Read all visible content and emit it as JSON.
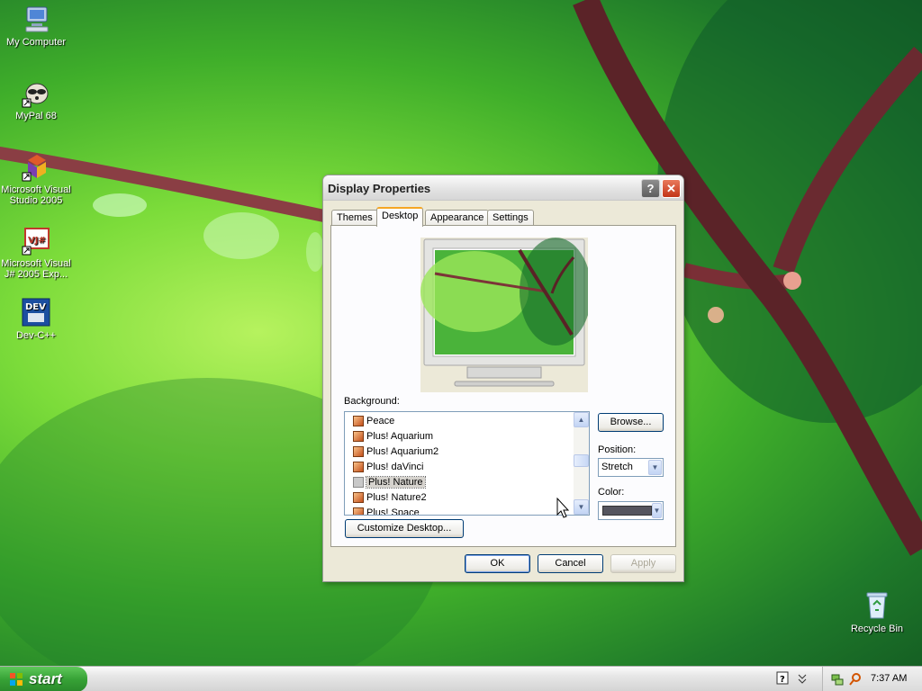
{
  "desktop": {
    "icons": [
      {
        "label": "My Computer"
      },
      {
        "label": "MyPal 68"
      },
      {
        "label": "Microsoft Visual Studio 2005"
      },
      {
        "label": "Microsoft Visual J# 2005 Exp..."
      },
      {
        "label": "Dev-C++"
      },
      {
        "label": "Recycle Bin"
      }
    ]
  },
  "dialog": {
    "title": "Display Properties",
    "help_glyph": "?",
    "close_glyph": "✕",
    "tabs": [
      {
        "label": "Themes",
        "active": false
      },
      {
        "label": "Desktop",
        "active": true
      },
      {
        "label": "Appearance",
        "active": false
      },
      {
        "label": "Settings",
        "active": false
      }
    ],
    "background_label": "Background:",
    "background_items": [
      "Peace",
      "Plus! Aquarium",
      "Plus! Aquarium2",
      "Plus! daVinci",
      "Plus! Nature",
      "Plus! Nature2",
      "Plus! Space"
    ],
    "selected_background": "Plus! Nature",
    "browse_label": "Browse...",
    "position_label": "Position:",
    "position_value": "Stretch",
    "color_label": "Color:",
    "color_value": "#55555e",
    "customize_label": "Customize Desktop...",
    "ok_label": "OK",
    "cancel_label": "Cancel",
    "apply_label": "Apply"
  },
  "taskbar": {
    "start_label": "start",
    "clock": "7:37 AM"
  },
  "colors": {
    "start_green": "#37a236",
    "tab_highlight": "#f5a623",
    "dialog_face": "#ece9d8"
  }
}
